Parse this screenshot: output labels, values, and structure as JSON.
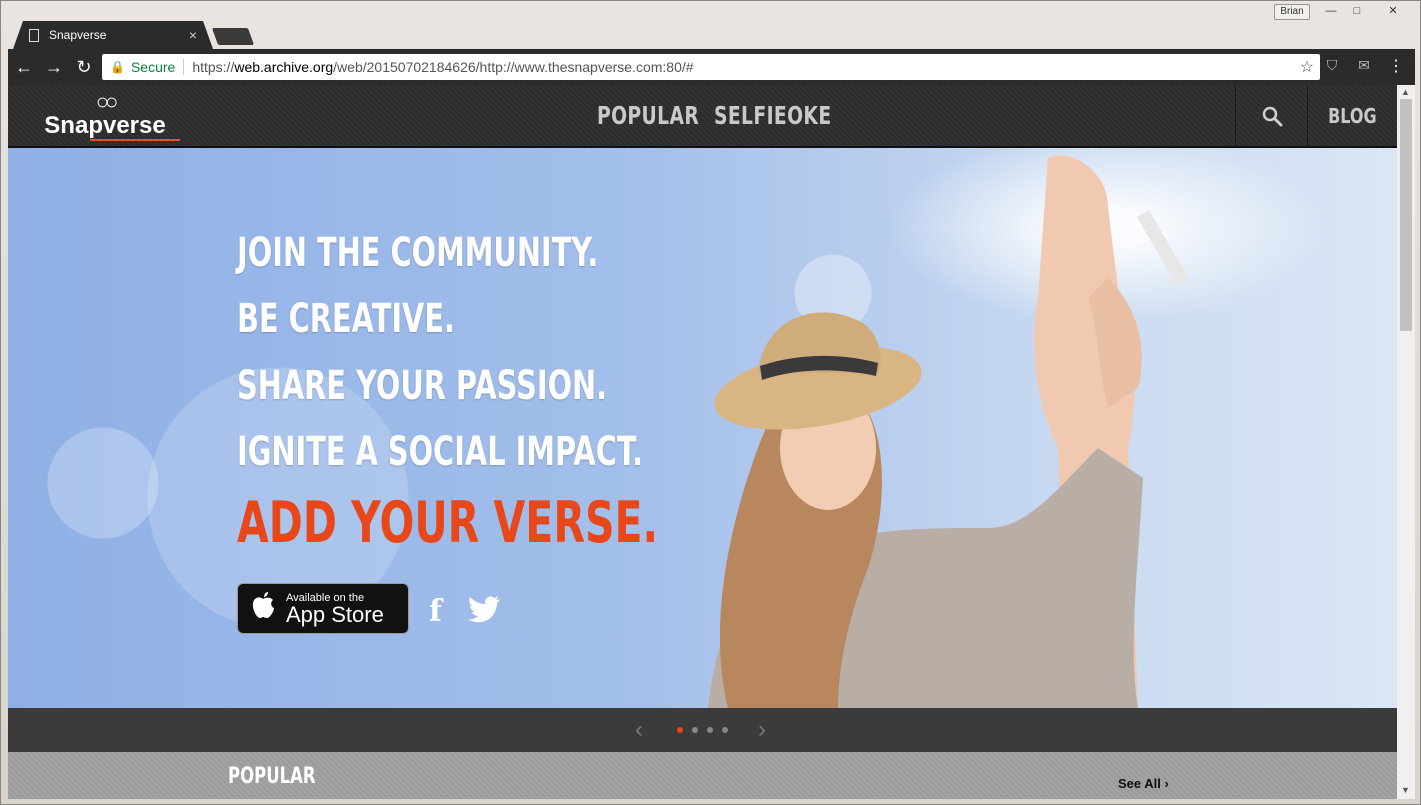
{
  "browser": {
    "tab_title": "Snapverse",
    "tab_close": "×",
    "user": "Brian",
    "win_min": "—",
    "win_max": "□",
    "win_close": "✕",
    "nav_back": "←",
    "nav_forward": "→",
    "nav_reload": "↻",
    "secure_label": "Secure",
    "url_prefix": "https://",
    "url_host": "web.archive.org",
    "url_path": "/web/20150702184626/http://www.thesnapverse.com:80/#",
    "star": "☆",
    "menu": "⋮"
  },
  "site": {
    "logo_mark": "○○",
    "logo_text": "Snapverse",
    "nav": [
      "POPULAR",
      "SELFIEOKE"
    ],
    "search_glyph": "⚲",
    "blog": "BLOG"
  },
  "hero": {
    "lines": [
      "JOIN THE COMMUNITY.",
      "BE CREATIVE.",
      "SHARE YOUR PASSION.",
      "IGNITE A SOCIAL IMPACT."
    ],
    "cta": "ADD YOUR VERSE.",
    "appstore_small": "Available on the",
    "appstore_big": "App Store",
    "facebook": "f",
    "twitter": "🐦"
  },
  "carousel": {
    "prev": "‹",
    "next": "›",
    "active_index": 0,
    "count": 4
  },
  "popular": {
    "title": "POPULAR",
    "see_all": "See All ›"
  },
  "colors": {
    "accent": "#e8471a",
    "header_bg": "#2c2c2c",
    "sky": "#a3bfea"
  }
}
